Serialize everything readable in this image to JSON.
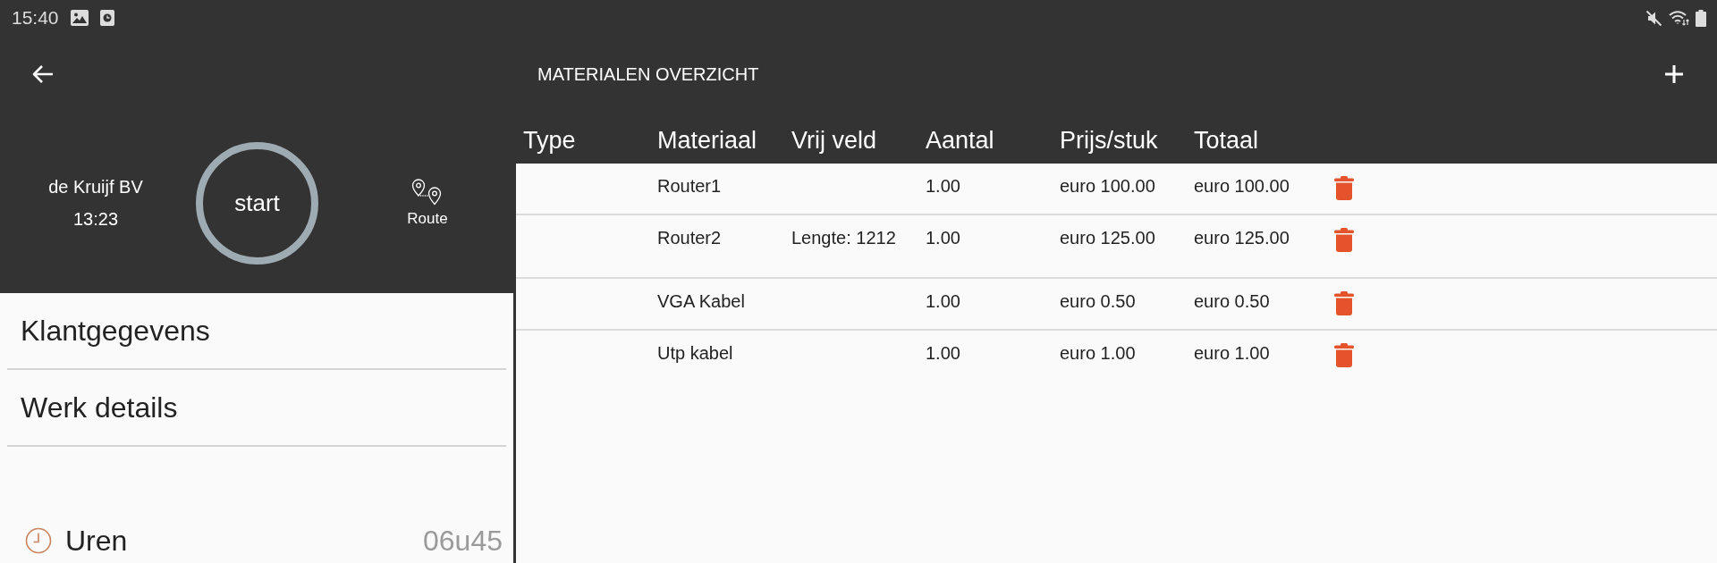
{
  "status_bar": {
    "time": "15:40"
  },
  "job": {
    "customer": "de Kruijf BV",
    "time": "13:23",
    "start_label": "start",
    "route_label": "Route"
  },
  "sidebar": {
    "items": [
      {
        "label": "Klantgegevens"
      },
      {
        "label": "Werk details"
      }
    ],
    "hours": {
      "label": "Uren",
      "value": "06u45"
    }
  },
  "materials": {
    "title": "MATERIALEN OVERZICHT",
    "columns": [
      "Type",
      "Materiaal",
      "Vrij veld",
      "Aantal",
      "Prijs/stuk",
      "Totaal"
    ],
    "rows": [
      {
        "material": "Router1",
        "quantity": "1.00",
        "unit_price": "euro 100.00",
        "total": "euro 100.00"
      },
      {
        "material": "Router2",
        "free_field": "Lengte: 1212",
        "quantity": "1.00",
        "unit_price": "euro 125.00",
        "total": "euro 125.00"
      },
      {
        "material": "VGA Kabel",
        "quantity": "1.00",
        "unit_price": "euro 0.50",
        "total": "euro 0.50"
      },
      {
        "material": "Utp kabel",
        "quantity": "1.00",
        "unit_price": "euro 1.00",
        "total": "euro 1.00"
      }
    ]
  }
}
